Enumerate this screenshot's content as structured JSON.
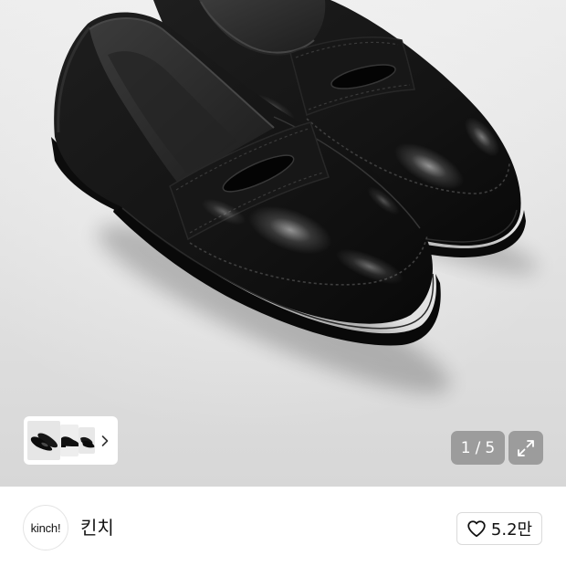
{
  "gallery": {
    "current": 1,
    "separator": "/",
    "total": 5,
    "more_thumbnails_icon": "chevron-right-icon",
    "expand_icon": "expand-icon"
  },
  "brand": {
    "logo_text": "kinch!",
    "name": "킨치"
  },
  "like": {
    "icon": "heart-outline-icon",
    "count_label": "5.2만"
  },
  "colors": {
    "photo_bg_top": "#ededed",
    "photo_bg_bottom": "#d7d7d7",
    "overlay": "#9c9c9c",
    "surface": "#ffffff",
    "text_primary": "#111111",
    "border": "#dadada"
  }
}
